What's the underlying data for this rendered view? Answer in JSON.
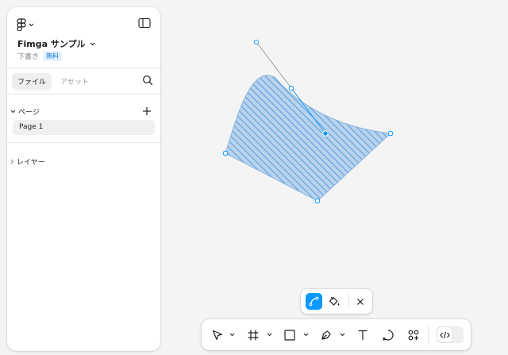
{
  "file": {
    "name": "Fimga サンプル",
    "status": "下書き",
    "plan_badge": "無料"
  },
  "sidebar": {
    "tabs": [
      {
        "label": "ファイル",
        "active": true
      },
      {
        "label": "アセット",
        "active": false
      }
    ],
    "pages_label": "ページ",
    "pages": [
      {
        "label": "Page 1",
        "selected": true
      }
    ],
    "layers_label": "レイヤー"
  },
  "vector_edit_bar": {
    "tools": [
      "bend-path-icon",
      "paint-bucket-icon",
      "close-icon"
    ],
    "active_tool": "bend-path-icon"
  },
  "toolbar": {
    "tools": [
      "move-icon",
      "frame-icon",
      "rectangle-icon",
      "pen-icon",
      "text-icon",
      "comment-icon",
      "actions-icon"
    ],
    "dev_mode_toggle": "code-icon"
  },
  "colors": {
    "accent": "#0d99ff",
    "shape_fill": "#a7c8e8",
    "shape_hatch": "#3b8fe0",
    "canvas": "#f4f4f4"
  }
}
